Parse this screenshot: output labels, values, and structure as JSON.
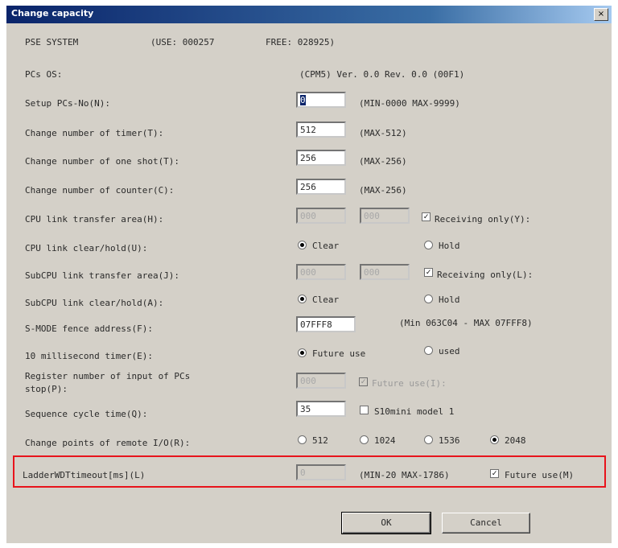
{
  "window": {
    "title": "Change capacity",
    "close_glyph": "×"
  },
  "header": {
    "system_label": "PSE SYSTEM",
    "use": "(USE: 000257",
    "free": "FREE: 028925)"
  },
  "pcs_os": {
    "label": "PCs OS:",
    "value": "(CPM5)  Ver. 0.0  Rev. 0.0  (00F1)"
  },
  "rows": {
    "setup_pcs_no": {
      "label": "Setup PCs-No(N):",
      "value": "0",
      "range": "(MIN-0000  MAX-9999)"
    },
    "timer": {
      "label": "Change number of timer(T):",
      "value": "512",
      "range": "(MAX-512)"
    },
    "one_shot": {
      "label": "Change number of one shot(T):",
      "value": "256",
      "range": "(MAX-256)"
    },
    "counter": {
      "label": "Change number of counter(C):",
      "value": "256",
      "range": "(MAX-256)"
    },
    "cpu_link_transfer": {
      "label": "CPU link transfer area(H):",
      "value1": "000",
      "value2": "000",
      "check_label": "Receiving only(Y):",
      "checked": true
    },
    "cpu_link_clear": {
      "label": "CPU link clear/hold(U):",
      "option1": "Clear",
      "option2": "Hold",
      "selected": "option1"
    },
    "subcpu_link_transfer": {
      "label": "SubCPU link transfer area(J):",
      "value1": "000",
      "value2": "000",
      "check_label": "Receiving only(L):",
      "checked": true
    },
    "subcpu_link_clear": {
      "label": "SubCPU link clear/hold(A):",
      "option1": "Clear",
      "option2": "Hold",
      "selected": "option1"
    },
    "smode_fence": {
      "label": "S-MODE fence address(F):",
      "value": "07FFF8",
      "range": "(Min 063C04 - MAX 07FFF8)"
    },
    "ms_timer": {
      "label": "10 millisecond timer(E):",
      "option1": "Future use",
      "option2": "used",
      "selected": "option1"
    },
    "register_input": {
      "label_line1": "Register number of input of PCs",
      "label_line2": "stop(P):",
      "value": "000",
      "check_label": "Future use(I):",
      "checked": true
    },
    "sequence_cycle": {
      "label": "Sequence cycle time(Q):",
      "value": "35",
      "check_label": "S10mini model 1",
      "checked": false
    },
    "remote_io": {
      "label": "Change points of remote I/O(R):",
      "options": [
        "512",
        "1024",
        "1536",
        "2048"
      ],
      "selected_index": 3
    },
    "ladder_wdt": {
      "label": "LadderWDTtimeout[ms](L)",
      "value": "0",
      "range": "(MIN-20 MAX-1786)",
      "check_label": "Future use(M)",
      "checked": true
    }
  },
  "buttons": {
    "ok": "OK",
    "cancel": "Cancel"
  },
  "colors": {
    "dialog_bg": "#d4d0c8",
    "titlebar": "#0a246a",
    "highlight": "#e8141c"
  }
}
